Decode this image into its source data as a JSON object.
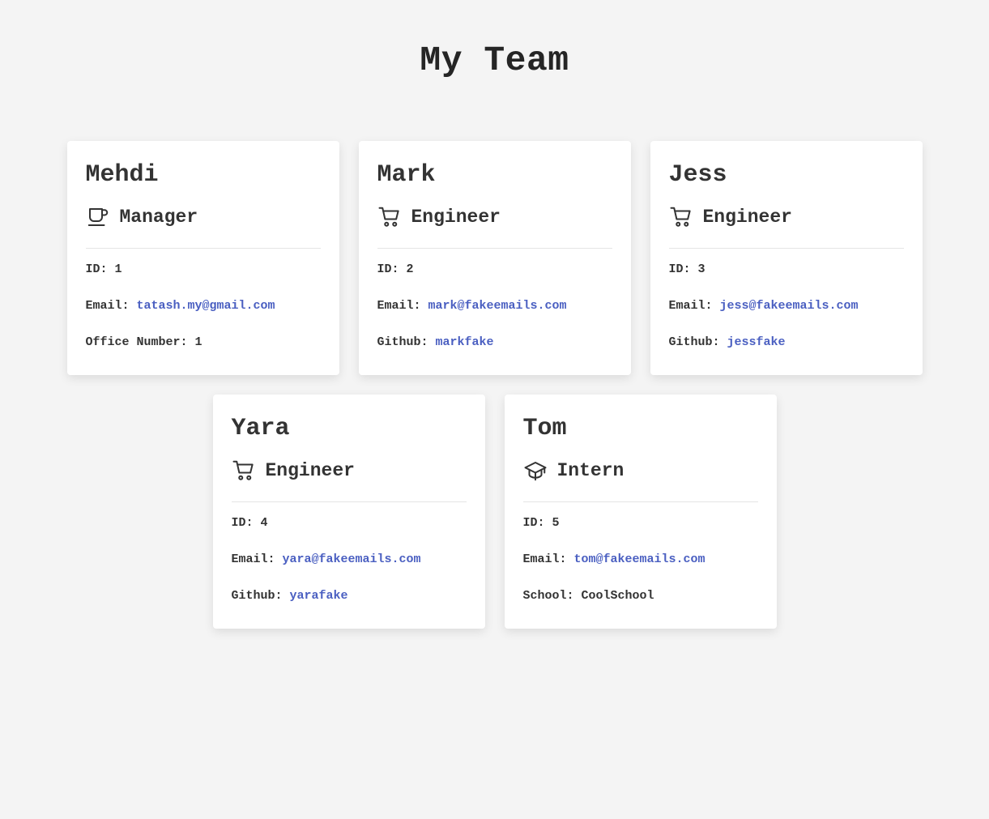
{
  "header": {
    "title": "My Team"
  },
  "labels": {
    "id": "ID: ",
    "email": "Email: ",
    "office": "Office Number: ",
    "github": "Github: ",
    "school": "School: "
  },
  "colors": {
    "link": "#4a5fc1",
    "text": "#333333",
    "background": "#f4f4f4"
  },
  "team": [
    {
      "name": "Mehdi",
      "role": "Manager",
      "icon": "coffee-cup-icon",
      "id": "1",
      "email": "tatash.my@gmail.com",
      "office": "1"
    },
    {
      "name": "Mark",
      "role": "Engineer",
      "icon": "shopping-cart-icon",
      "id": "2",
      "email": "mark@fakeemails.com",
      "github": "markfake"
    },
    {
      "name": "Jess",
      "role": "Engineer",
      "icon": "shopping-cart-icon",
      "id": "3",
      "email": "jess@fakeemails.com",
      "github": "jessfake"
    },
    {
      "name": "Yara",
      "role": "Engineer",
      "icon": "shopping-cart-icon",
      "id": "4",
      "email": "yara@fakeemails.com",
      "github": "yarafake"
    },
    {
      "name": "Tom",
      "role": "Intern",
      "icon": "graduation-cap-icon",
      "id": "5",
      "email": "tom@fakeemails.com",
      "school": "CoolSchool"
    }
  ]
}
